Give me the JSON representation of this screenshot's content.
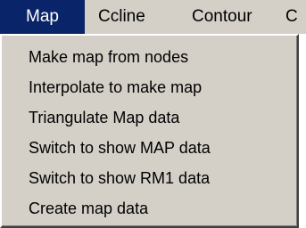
{
  "menubar": {
    "items": [
      {
        "label": "Map"
      },
      {
        "label": "Ccline"
      },
      {
        "label": "Contour"
      },
      {
        "label": "C"
      }
    ]
  },
  "dropdown": {
    "items": [
      {
        "label": "Make map from nodes"
      },
      {
        "label": "Interpolate to make map"
      },
      {
        "label": "Triangulate Map data"
      },
      {
        "label": "Switch to show MAP data"
      },
      {
        "label": "Switch to show RM1 data"
      },
      {
        "label": "Create map data"
      }
    ]
  },
  "colors": {
    "menu_face": "#d4d0c8",
    "highlight": "#0a246a",
    "highlight_text": "#ffffff",
    "text": "#000000"
  }
}
